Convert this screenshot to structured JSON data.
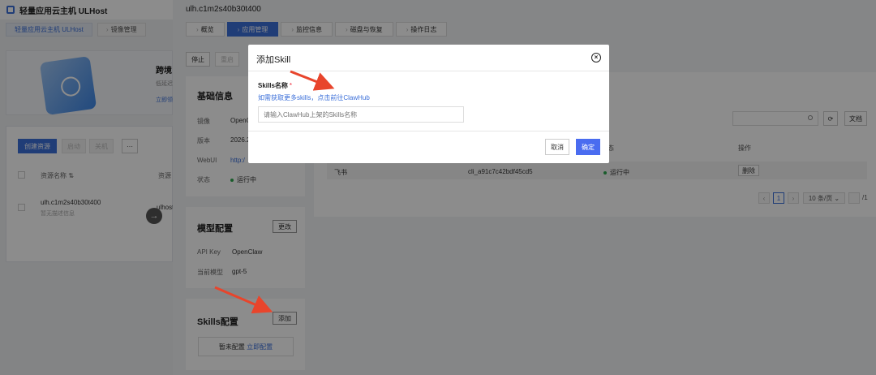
{
  "app": {
    "title": "轻量应用云主机 ULHost"
  },
  "bg_tabs": [
    "轻量应用云主机 ULHost",
    "镜像管理"
  ],
  "banner": {
    "title": "跨境",
    "sub1": "低延迟",
    "sub2": "立即领"
  },
  "list": {
    "create_label": "创建资源",
    "ghost1": "启动",
    "ghost2": "关机",
    "more": "···",
    "col_name": "资源名称",
    "col_res": "资源",
    "row_name": "ulh.c1m2s40b30t400",
    "row_sub": "暂无描述信息",
    "row_name2": "ulhost"
  },
  "drawer": {
    "title": "ulh.c1m2s40b30t400",
    "tabs": [
      "概览",
      "应用管理",
      "监控信息",
      "磁盘与恢复",
      "操作日志"
    ],
    "stop": "停止",
    "restart": "重启"
  },
  "basic": {
    "title": "基础信息",
    "rows": [
      {
        "k": "镜像",
        "v": "OpenC"
      },
      {
        "k": "版本",
        "v": "2026.2"
      },
      {
        "k": "WebUI",
        "v": "http:/"
      },
      {
        "k": "状态",
        "v": "运行中"
      }
    ]
  },
  "model": {
    "title": "模型配置",
    "edit": "更改",
    "rows": [
      {
        "k": "API Key",
        "v": "OpenClaw"
      },
      {
        "k": "当前模型",
        "v": "gpt-5"
      }
    ]
  },
  "skills": {
    "title": "Skills配置",
    "add": "添加",
    "empty": "暂未配置",
    "empty_link": "立即配置"
  },
  "table": {
    "search_placeholder": "",
    "doc_label": "文档",
    "col_status": "态",
    "col_op": "操作",
    "row": {
      "name": "飞书",
      "id": "cli_a91c7c42bdf45cd5",
      "status": "运行中",
      "op": "删除"
    },
    "page_current": "1",
    "page_size": "10 条/页",
    "page_total": "/1"
  },
  "modal": {
    "title": "添加Skill",
    "field_label": "Skills名称",
    "required_mark": "*",
    "hint": "如需获取更多skills，点击前往",
    "hint_link": "ClawHub",
    "placeholder": "请输入ClawHub上架的Skills名称",
    "cancel": "取消",
    "ok": "确定"
  },
  "colors": {
    "accent": "#3b6fd9",
    "primary_btn": "#4a6cf0",
    "arrow": "#e8452c"
  },
  "icons": [
    "logo-icon",
    "close-icon",
    "search-icon",
    "refresh-icon",
    "arrow-right-icon"
  ]
}
